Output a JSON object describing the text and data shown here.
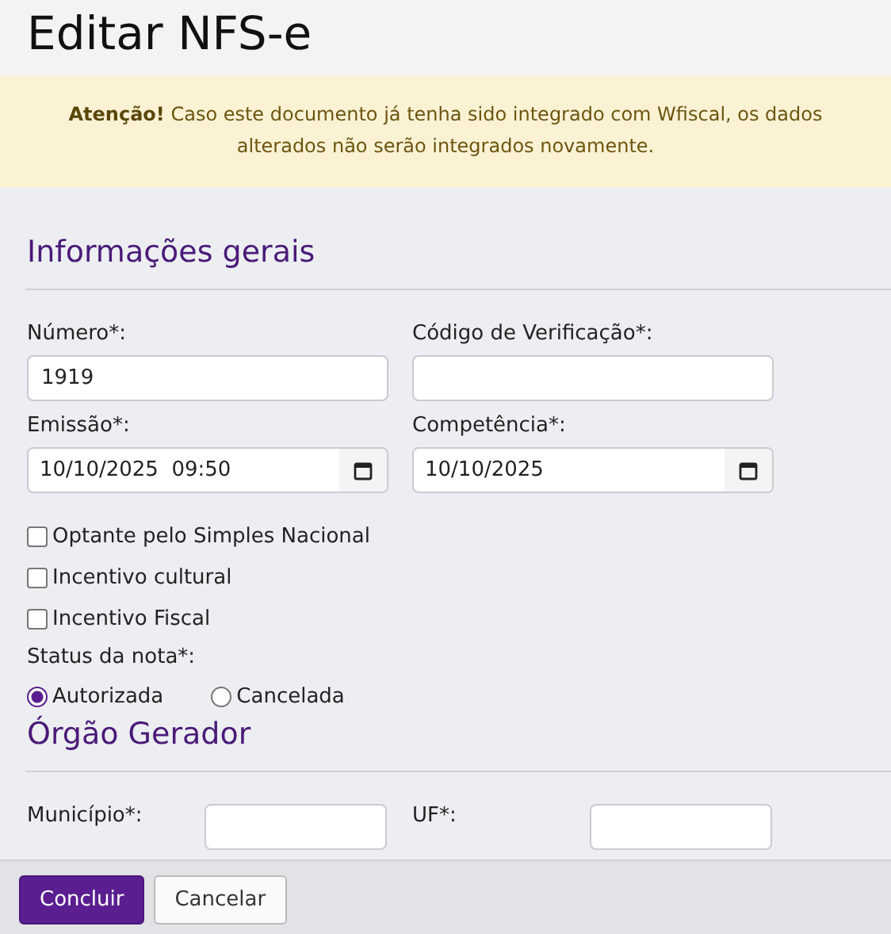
{
  "title": "Editar NFS-e",
  "alert": {
    "text": "**Atenção!** Caso este documento já tenha sido integrado com Wfiscal, os dados alterados não serão integrados novamente."
  },
  "sections": [
    {
      "title": "Informações gerais",
      "fields": [
        {
          "kind": "text",
          "label": "Número*:",
          "value": "1919"
        },
        {
          "kind": "text",
          "label": "Código de Verificação*:"
        },
        {
          "kind": "date",
          "label": "Emissão*:",
          "value": "10/10/2025  09:50"
        },
        {
          "kind": "date",
          "label": "Competência*:",
          "value": "10/10/2025"
        }
      ],
      "checkboxes": [
        {
          "label": "Optante pelo Simples Nacional",
          "checked": false
        },
        {
          "label": "Incentivo cultural",
          "checked": false
        },
        {
          "label": "Incentivo Fiscal",
          "checked": false
        }
      ],
      "radio_group": {
        "label": "Status da nota*:",
        "options": [
          {
            "label": "Autorizada",
            "selected": true
          },
          {
            "label": "Cancelada",
            "selected": false
          }
        ]
      }
    },
    {
      "title": "Órgão Gerador",
      "inline_fields": [
        {
          "label": "Município*:"
        },
        {
          "label": "UF*:"
        }
      ]
    }
  ],
  "buttons": [
    {
      "kind": "primary",
      "label": "Concluir"
    },
    {
      "kind": "secondary",
      "label": "Cancelar"
    }
  ]
}
